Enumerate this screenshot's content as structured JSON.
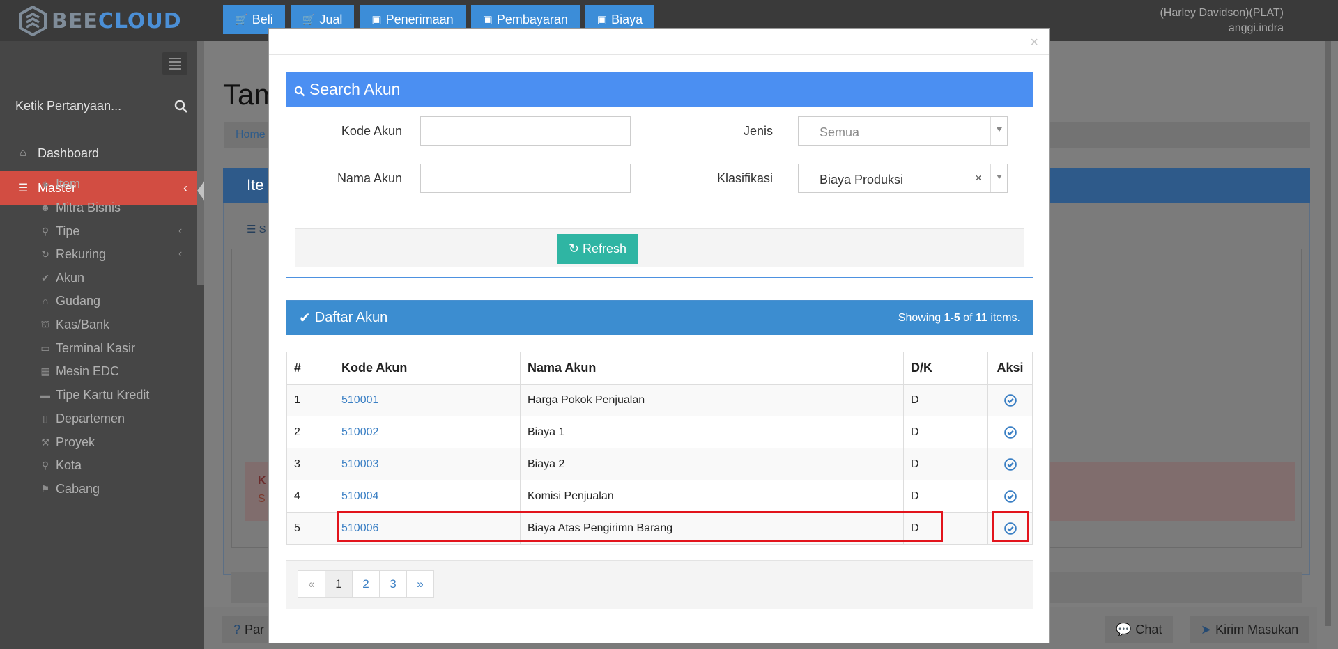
{
  "app": {
    "logo_part1": "BEE",
    "logo_part2": "CLOUD",
    "user_company": "(Harley Davidson)(PLAT)",
    "user_name": "anggi.indra"
  },
  "topnav": [
    {
      "label": "Beli",
      "icon": "cart-icon"
    },
    {
      "label": "Jual",
      "icon": "cart-icon"
    },
    {
      "label": "Penerimaan",
      "icon": "money-icon"
    },
    {
      "label": "Pembayaran",
      "icon": "money-icon"
    },
    {
      "label": "Biaya",
      "icon": "money-icon"
    }
  ],
  "sidebar": {
    "search_placeholder": "Ketik Pertanyaan...",
    "dashboard": "Dashboard",
    "master": "Master",
    "items": [
      {
        "label": "Item",
        "icon": "cube-icon"
      },
      {
        "label": "Mitra Bisnis",
        "icon": "users-icon"
      },
      {
        "label": "Tipe",
        "icon": "sitemap-icon"
      },
      {
        "label": "Rekuring",
        "icon": "refresh-icon"
      },
      {
        "label": "Akun",
        "icon": "check-icon"
      },
      {
        "label": "Gudang",
        "icon": "home-icon"
      },
      {
        "label": "Kas/Bank",
        "icon": "bank-icon"
      },
      {
        "label": "Terminal Kasir",
        "icon": "desktop-icon"
      },
      {
        "label": "Mesin EDC",
        "icon": "calculator-icon"
      },
      {
        "label": "Tipe Kartu Kredit",
        "icon": "credit-card-icon"
      },
      {
        "label": "Departemen",
        "icon": "clipboard-icon"
      },
      {
        "label": "Proyek",
        "icon": "gavel-icon"
      },
      {
        "label": "Kota",
        "icon": "map-marker-icon"
      },
      {
        "label": "Cabang",
        "icon": "flag-icon"
      }
    ]
  },
  "background": {
    "title": "Tam",
    "breadcrumb": "Home",
    "panel_title": "Ite",
    "tab": "S",
    "alert_k": "K",
    "alert_s": "S",
    "help_button": "Par",
    "chat_button": "Chat",
    "feedback_button": "Kirim Masukan"
  },
  "modal": {
    "close": "×",
    "search_panel": {
      "title": "Search Akun",
      "kode_label": "Kode Akun",
      "kode_value": "",
      "nama_label": "Nama Akun",
      "nama_value": "",
      "jenis_label": "Jenis",
      "jenis_value": "Semua",
      "klasifikasi_label": "Klasifikasi",
      "klasifikasi_value": "Biaya Produksi",
      "clear": "×",
      "refresh": "Refresh"
    },
    "list_panel": {
      "title": "Daftar Akun",
      "summary_prefix": "Showing ",
      "summary_range": "1-5",
      "summary_of": " of ",
      "summary_total": "11",
      "summary_suffix": " items.",
      "columns": [
        "#",
        "Kode Akun",
        "Nama Akun",
        "D/K",
        "Aksi"
      ],
      "rows": [
        {
          "no": "1",
          "kode": "510001",
          "nama": "Harga Pokok Penjualan",
          "dk": "D"
        },
        {
          "no": "2",
          "kode": "510002",
          "nama": "Biaya 1",
          "dk": "D"
        },
        {
          "no": "3",
          "kode": "510003",
          "nama": "Biaya 2",
          "dk": "D"
        },
        {
          "no": "4",
          "kode": "510004",
          "nama": "Komisi Penjualan",
          "dk": "D"
        },
        {
          "no": "5",
          "kode": "510006",
          "nama": "Biaya Atas Pengirimn Barang",
          "dk": "D"
        }
      ],
      "pager": {
        "prev": "«",
        "pages": [
          "1",
          "2",
          "3"
        ],
        "next": "»"
      }
    }
  },
  "colors": {
    "accent_blue": "#4b8ff2",
    "panel_blue": "#3c8dd0",
    "active_red": "#d24d42",
    "refresh_teal": "#2fb5a3",
    "highlight_red": "#e2141c"
  }
}
